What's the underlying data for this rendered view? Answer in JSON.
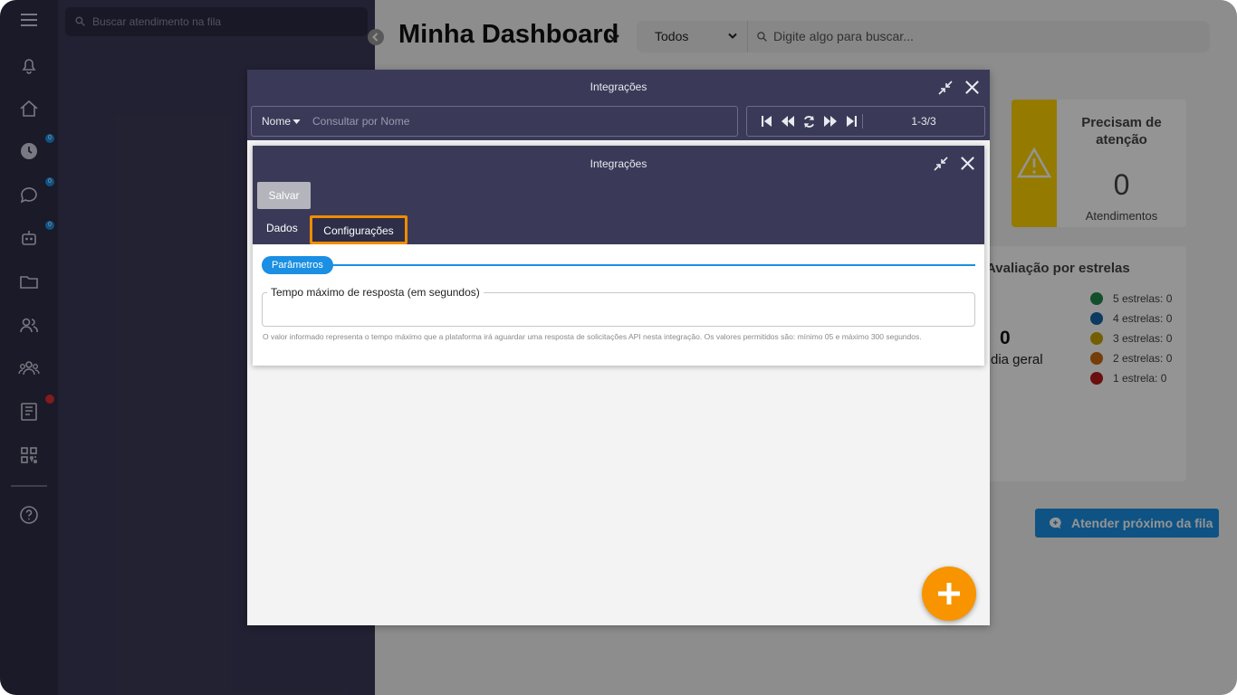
{
  "queue": {
    "search_placeholder": "Buscar atendimento na fila"
  },
  "rail": {
    "badges": [
      "0",
      "0",
      "0"
    ]
  },
  "dashboard": {
    "title": "Minha Dashboard",
    "filter_value": "Todos",
    "search_placeholder": "Digite algo para buscar...",
    "attention_card": {
      "title": "Precisam de atenção",
      "count": "0",
      "subtitle": "Atendimentos"
    },
    "stars_card": {
      "title": "Avaliação por estrelas",
      "average_value": "0",
      "average_label": "dia geral",
      "rows": [
        {
          "label": "5 estrelas: 0",
          "color": "#1f8a4c"
        },
        {
          "label": "4 estrelas: 0",
          "color": "#1565a8"
        },
        {
          "label": "3 estrelas: 0",
          "color": "#c9a400"
        },
        {
          "label": "2 estrelas: 0",
          "color": "#c96a12"
        },
        {
          "label": "1 estrela: 0",
          "color": "#b51b1b"
        }
      ]
    },
    "next_button": "Atender próximo da fila"
  },
  "outer_window": {
    "title": "Integrações",
    "filter_field": "Nome",
    "filter_placeholder": "Consultar por Nome",
    "page_count": "1-3/3"
  },
  "inner_window": {
    "title": "Integrações",
    "save_label": "Salvar",
    "tabs": [
      "Dados",
      "Configurações"
    ],
    "section_label": "Parâmetros",
    "field_label": "Tempo máximo de resposta (em segundos)",
    "field_value": "",
    "hint": "O valor informado representa o tempo máximo que a plataforma irá aguardar uma resposta de solicitações API nesta integração. Os valores permitidos são: mínimo 05 e máximo 300 segundos."
  },
  "colors": {
    "accent": "#1a8fe3",
    "fab": "#f79400",
    "highlight": "#f08c00",
    "warning": "#ffd500",
    "dark": "#3a3a58"
  }
}
